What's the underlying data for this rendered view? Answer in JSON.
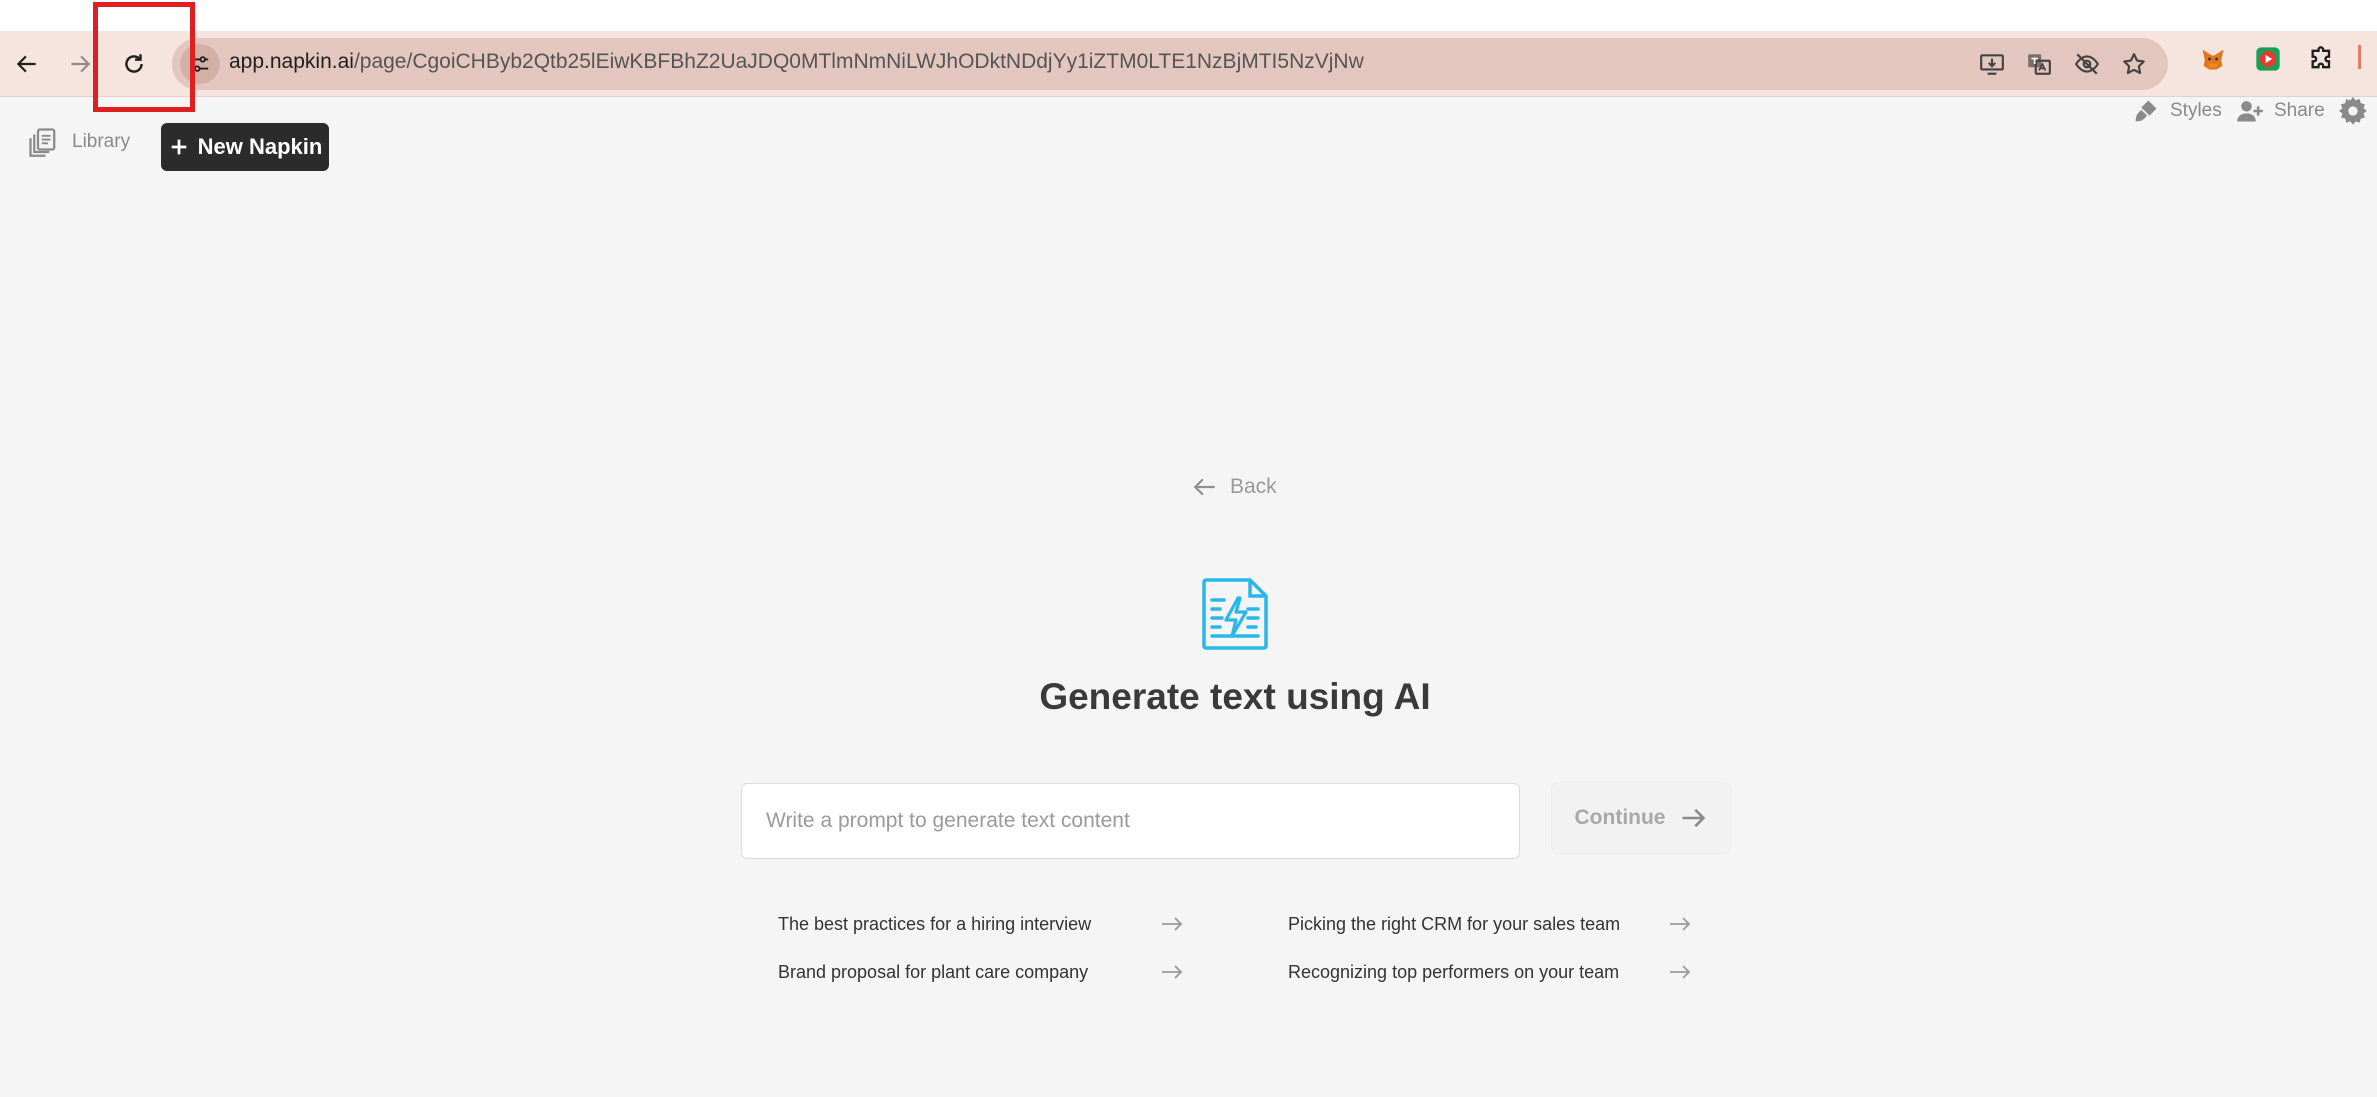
{
  "browser": {
    "url_host": "app.napkin.ai",
    "url_path": "/page/CgoiCHByb2Qtb25lEiwKBFBhZ2UaJDQ0MTlmNmNiLWJhODktNDdjYy1iZTM0LTE1NzBjMTI5NzVjNw"
  },
  "header": {
    "library_label": "Library",
    "new_napkin_label": "New Napkin",
    "styles_label": "Styles",
    "share_label": "Share"
  },
  "main": {
    "back_label": "Back",
    "title": "Generate text using AI",
    "prompt_placeholder": "Write a prompt to generate text content",
    "continue_label": "Continue",
    "suggestions": [
      "The best practices for a hiring interview",
      "Picking the right CRM for your sales team",
      "Brand proposal for plant care company",
      "Recognizing top performers on your team"
    ]
  },
  "colors": {
    "browser_bar": "#f6e4de",
    "omnibox": "#e3c6bd",
    "accent_icon": "#29b6e8",
    "highlight": "#e02020",
    "primary_button": "#2b2b2b"
  }
}
